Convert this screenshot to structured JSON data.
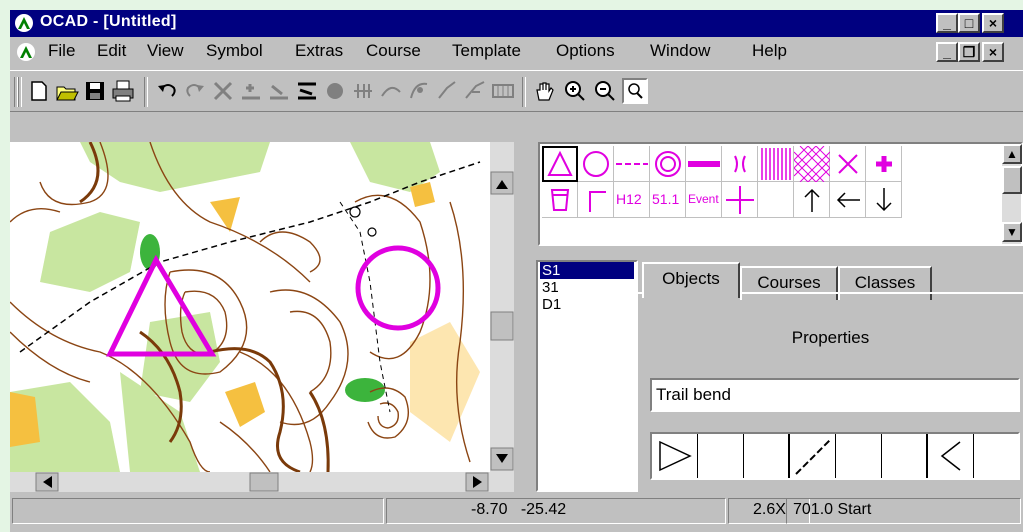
{
  "window": {
    "title": "OCAD  - [Untitled]",
    "controls": {
      "minimize": "_",
      "maximize": "□",
      "close": "×"
    },
    "child_controls": {
      "minimize": "_",
      "restore": "❐",
      "close": "×"
    }
  },
  "menu": {
    "items": [
      "File",
      "Edit",
      "View",
      "Symbol",
      "Extras",
      "Course",
      "Template",
      "Options",
      "Window",
      "Help"
    ]
  },
  "toolbar": {
    "tools": [
      "new-file-icon",
      "open-folder-icon",
      "save-disk-icon",
      "print-icon",
      "undo-icon",
      "redo-icon",
      "delete-icon",
      "cut-line-icon",
      "join-icon",
      "fill-icon",
      "rotate-icon",
      "measure-icon",
      "reshape-icon",
      "smooth-icon",
      "curve-icon",
      "stretch-icon",
      "grid-icon",
      "hand-pan-icon",
      "zoom-in-icon",
      "zoom-out-icon",
      "zoom-window-icon"
    ]
  },
  "symbols": {
    "row2_labels": [
      "H12",
      "51.1",
      "Event"
    ]
  },
  "course_list": {
    "items": [
      "S1",
      "31",
      "D1"
    ],
    "selected": "S1"
  },
  "tabs": [
    {
      "label": "Objects",
      "active": true
    },
    {
      "label": "Courses",
      "active": false
    },
    {
      "label": "Classes",
      "active": false
    }
  ],
  "objects_panel": {
    "heading": "Properties",
    "object_name": "Trail bend"
  },
  "status": {
    "coord_x": "-8.70",
    "coord_y": "-25.42",
    "zoom": "2.6X",
    "info": "701.0 Start"
  },
  "colors": {
    "title_bg": "#000080",
    "symbol_magenta": "#e000e0",
    "map_contour": "#8b4513",
    "map_vegetation": "#c8e6a0",
    "map_rough": "#f5c040",
    "selection": "#000080"
  }
}
